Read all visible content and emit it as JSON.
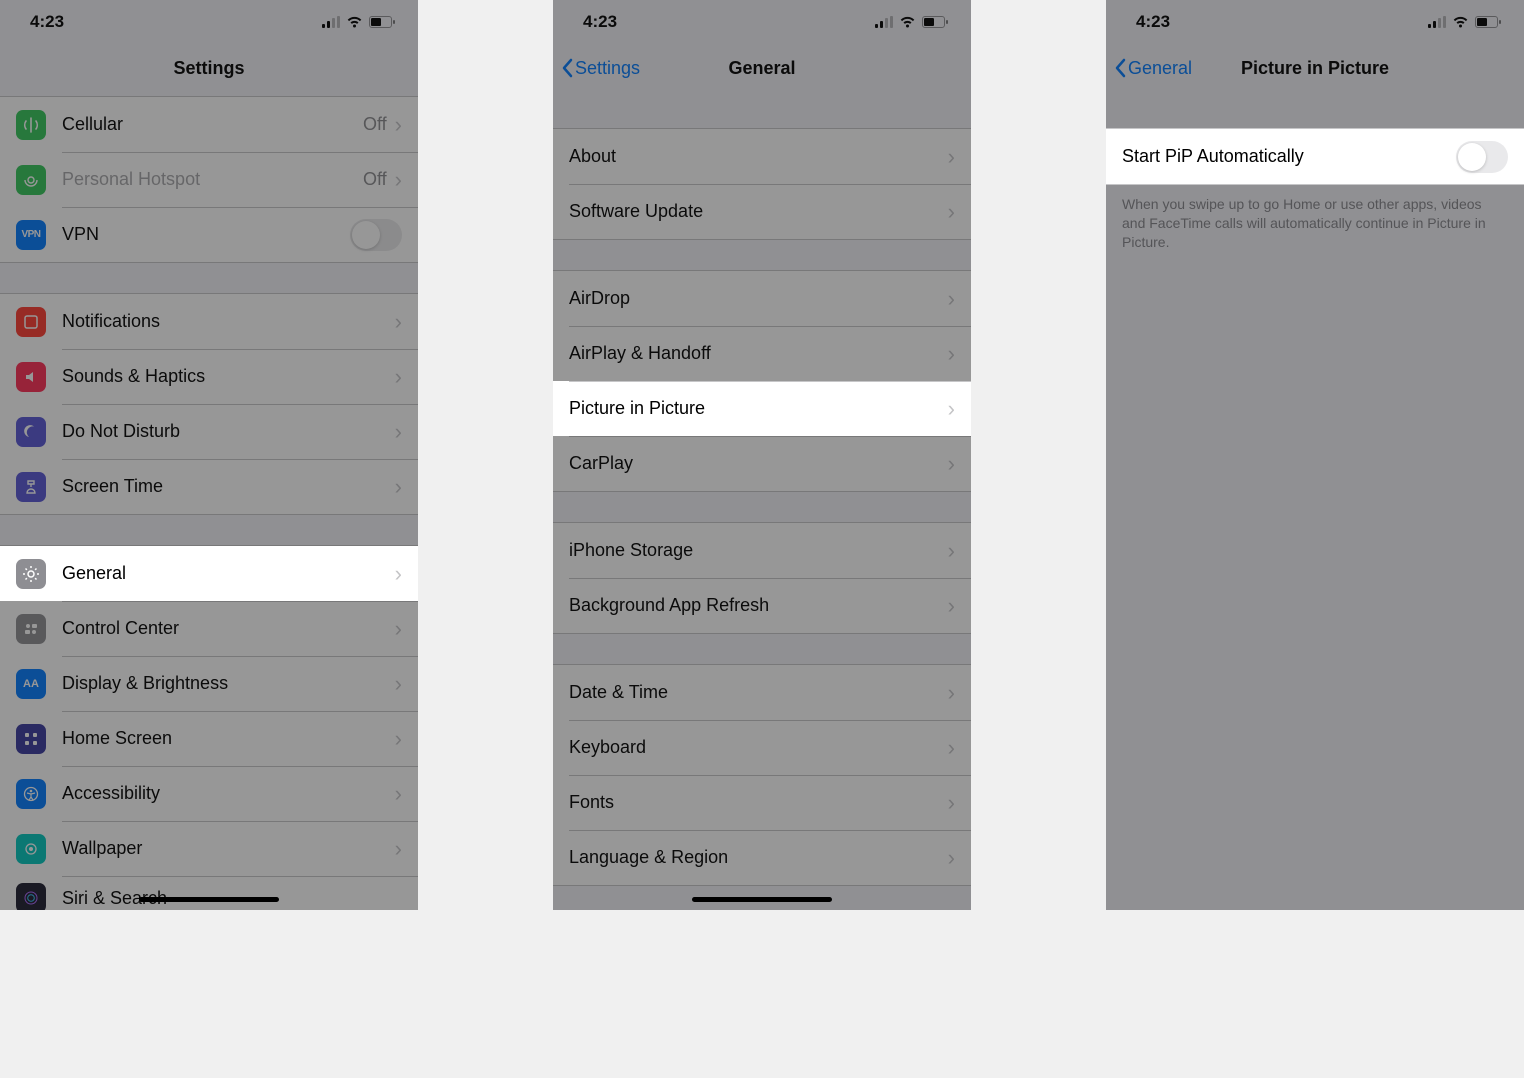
{
  "status": {
    "time": "4:23"
  },
  "colors": {
    "link": "#007aff"
  },
  "phone1": {
    "title": "Settings",
    "rows": {
      "cellular": {
        "label": "Cellular",
        "value": "Off"
      },
      "hotspot": {
        "label": "Personal Hotspot",
        "value": "Off"
      },
      "vpn": {
        "label": "VPN"
      },
      "notif": {
        "label": "Notifications"
      },
      "sounds": {
        "label": "Sounds & Haptics"
      },
      "dnd": {
        "label": "Do Not Disturb"
      },
      "screentime": {
        "label": "Screen Time"
      },
      "general": {
        "label": "General"
      },
      "control": {
        "label": "Control Center"
      },
      "display": {
        "label": "Display & Brightness"
      },
      "home": {
        "label": "Home Screen"
      },
      "access": {
        "label": "Accessibility"
      },
      "wallpaper": {
        "label": "Wallpaper"
      },
      "siri": {
        "label": "Siri & Search"
      }
    }
  },
  "phone2": {
    "back": "Settings",
    "title": "General",
    "rows": {
      "about": {
        "label": "About"
      },
      "software": {
        "label": "Software Update"
      },
      "airdrop": {
        "label": "AirDrop"
      },
      "airplay": {
        "label": "AirPlay & Handoff"
      },
      "pip": {
        "label": "Picture in Picture"
      },
      "carplay": {
        "label": "CarPlay"
      },
      "storage": {
        "label": "iPhone Storage"
      },
      "refresh": {
        "label": "Background App Refresh"
      },
      "datetime": {
        "label": "Date & Time"
      },
      "keyboard": {
        "label": "Keyboard"
      },
      "fonts": {
        "label": "Fonts"
      },
      "language": {
        "label": "Language & Region"
      }
    }
  },
  "phone3": {
    "back": "General",
    "title": "Picture in Picture",
    "toggle": {
      "label": "Start PiP Automatically",
      "on": false
    },
    "footer": "When you swipe up to go Home or use other apps, videos and FaceTime calls will automatically continue in Picture in Picture."
  }
}
